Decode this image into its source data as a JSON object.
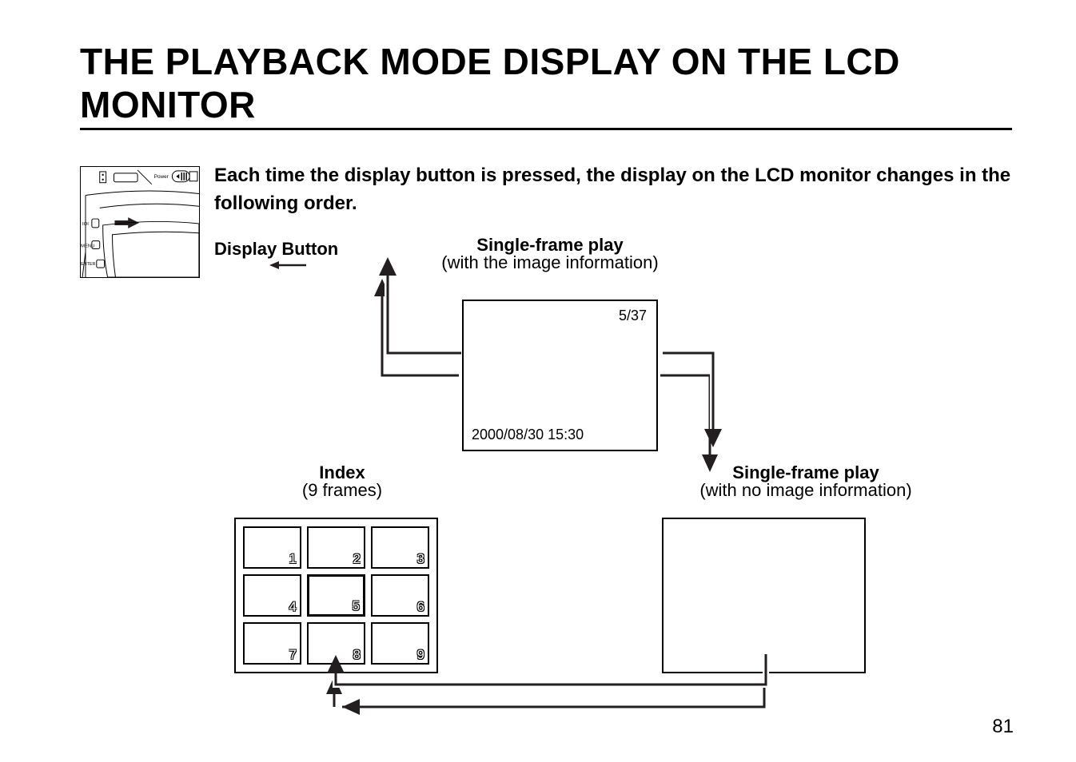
{
  "title": "THE PLAYBACK MODE DISPLAY ON THE LCD MONITOR",
  "intro": "Each time the display button is pressed, the display on the LCD monitor changes in the following order.",
  "displayButton": {
    "label": "Display Button"
  },
  "singleFrameInfo": {
    "title": "Single-frame play",
    "sub": "(with the image information)"
  },
  "indexView": {
    "title": "Index",
    "sub": "(9 frames)"
  },
  "singleFrameNoInfo": {
    "title": "Single-frame play",
    "sub": "(with no image information)"
  },
  "lcd": {
    "counter": "5/37",
    "datetime": "2000/08/30 15:30"
  },
  "indexCells": {
    "c1": "1",
    "c2": "2",
    "c3": "3",
    "c4": "4",
    "c5": "5",
    "c6": "6",
    "c7": "7",
    "c8": "8",
    "c9": "9"
  },
  "camera": {
    "power": "Power",
    "menu": "MENU",
    "enter": "ENTER",
    "io": "IOI"
  },
  "pageNumber": "81"
}
